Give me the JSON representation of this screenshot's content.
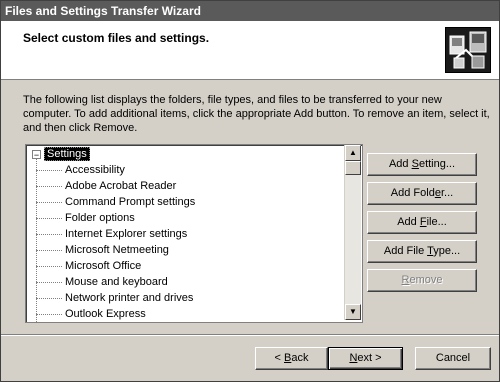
{
  "window": {
    "title": "Files and Settings Transfer Wizard"
  },
  "header": {
    "title": "Select custom files and settings."
  },
  "description": "The following list displays the folders, file types, and files to be transferred to your new computer. To add additional items, click the appropriate Add button. To remove an item, select it, and then click Remove.",
  "tree": {
    "root_label": "Settings",
    "expander": "−",
    "items": [
      "Accessibility",
      "Adobe Acrobat Reader",
      "Command Prompt settings",
      "Folder options",
      "Internet Explorer settings",
      "Microsoft Netmeeting",
      "Microsoft Office",
      "Mouse and keyboard",
      "Network printer and drives",
      "Outlook Express"
    ]
  },
  "scrollbar": {
    "up_arrow": "▲",
    "down_arrow": "▼"
  },
  "side_buttons": {
    "add_setting": {
      "pre": "Add ",
      "key": "S",
      "post": "etting..."
    },
    "add_folder": {
      "pre": "Add Fold",
      "key": "e",
      "post": "r..."
    },
    "add_file": {
      "pre": "Add ",
      "key": "F",
      "post": "ile..."
    },
    "add_file_type": {
      "pre": "Add File ",
      "key": "T",
      "post": "ype..."
    },
    "remove": {
      "pre": "",
      "key": "R",
      "post": "emove"
    }
  },
  "nav_buttons": {
    "back": {
      "pre": "< ",
      "key": "B",
      "post": "ack"
    },
    "next": {
      "pre": "",
      "key": "N",
      "post": "ext >"
    },
    "cancel": "Cancel"
  }
}
